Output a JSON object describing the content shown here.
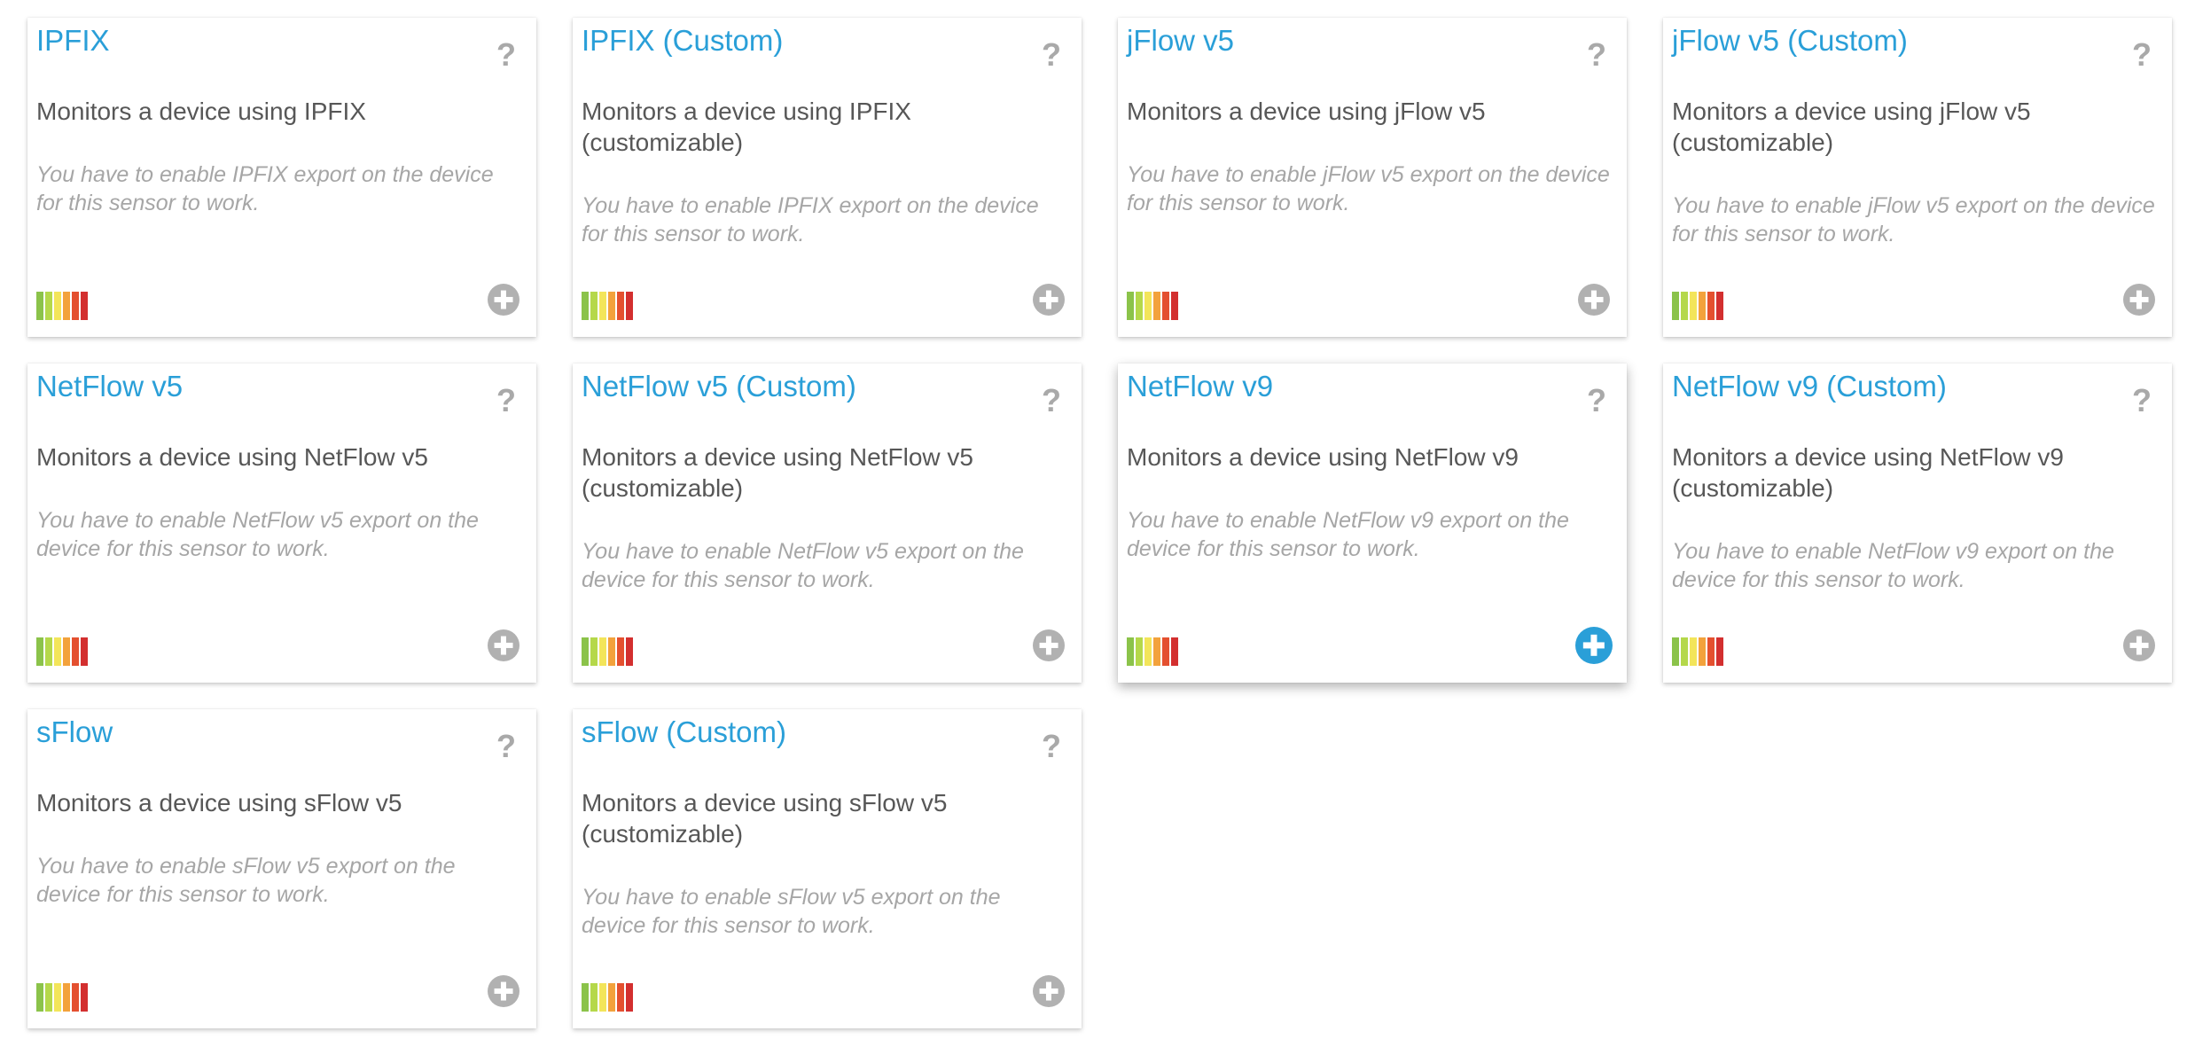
{
  "colors": {
    "title": "#2a9fd8",
    "description": "#575757",
    "note": "#a6a6a6",
    "icon_gray": "#b1b1b1",
    "add_active": "#2a9fd8",
    "performance_bar": [
      "#8bc34a",
      "#b5d84a",
      "#f3e55a",
      "#f3a23c",
      "#e4502f",
      "#d32f2f"
    ]
  },
  "icons": {
    "help": "?",
    "add": "plus-circle-icon",
    "performance": "performance-impact-bars-icon"
  },
  "cards": [
    {
      "title": "IPFIX",
      "description": "Monitors a device using IPFIX",
      "note": "You have to enable IPFIX export on the device for this sensor to work.",
      "add_active": false
    },
    {
      "title": "IPFIX (Custom)",
      "description": "Monitors a device using IPFIX (customizable)",
      "note": "You have to enable IPFIX export on the device for this sensor to work.",
      "add_active": false
    },
    {
      "title": "jFlow v5",
      "description": "Monitors a device using jFlow v5",
      "note": "You have to enable jFlow v5 export on the device for this sensor to work.",
      "add_active": false
    },
    {
      "title": "jFlow v5 (Custom)",
      "description": "Monitors a device using jFlow v5 (customizable)",
      "note": "You have to enable jFlow v5 export on the device for this sensor to work.",
      "add_active": false
    },
    {
      "title": "NetFlow v5",
      "description": "Monitors a device using NetFlow v5",
      "note": "You have to enable NetFlow v5 export on the device for this sensor to work.",
      "add_active": false
    },
    {
      "title": "NetFlow v5 (Custom)",
      "description": "Monitors a device using NetFlow v5 (customizable)",
      "note": "You have to enable NetFlow v5 export on the device for this sensor to work.",
      "add_active": false
    },
    {
      "title": "NetFlow v9",
      "description": "Monitors a device using NetFlow v9",
      "note": "You have to enable NetFlow v9 export on the device for this sensor to work.",
      "add_active": true
    },
    {
      "title": "NetFlow v9 (Custom)",
      "description": "Monitors a device using NetFlow v9 (customizable)",
      "note": "You have to enable NetFlow v9 export on the device for this sensor to work.",
      "add_active": false
    },
    {
      "title": "sFlow",
      "description": "Monitors a device using sFlow v5",
      "note": "You have to enable sFlow v5 export on the device for this sensor to work.",
      "add_active": false
    },
    {
      "title": "sFlow (Custom)",
      "description": "Monitors a device using sFlow v5 (customizable)",
      "note": "You have to enable sFlow v5 export on the device for this sensor to work.",
      "add_active": false
    }
  ]
}
